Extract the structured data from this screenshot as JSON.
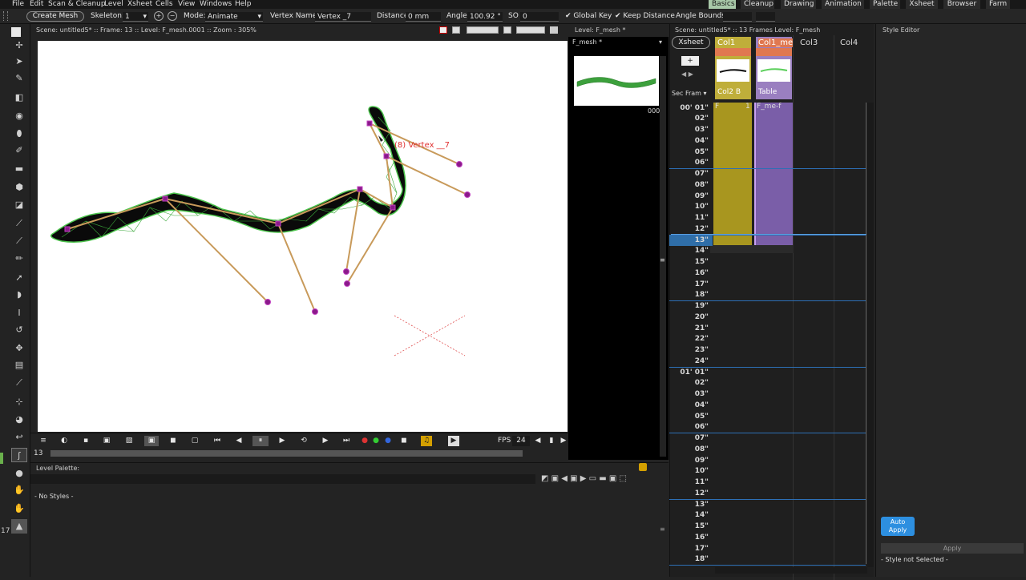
{
  "menu": [
    "File",
    "Edit",
    "Scan & Cleanup",
    "Level",
    "Xsheet",
    "Cells",
    "View",
    "Windows",
    "Help"
  ],
  "rooms": [
    {
      "label": "Basics",
      "active": true
    },
    {
      "label": "Cleanup",
      "active": false
    },
    {
      "label": "Drawing",
      "active": false
    },
    {
      "label": "Animation",
      "active": false
    },
    {
      "label": "Palette",
      "active": false
    },
    {
      "label": "Xsheet",
      "active": false
    },
    {
      "label": "Browser",
      "active": false
    },
    {
      "label": "Farm",
      "active": false
    }
  ],
  "tool_options": {
    "create_mesh": "Create Mesh",
    "skeleton_label": "Skeleton:",
    "skeleton_value": "1",
    "mode_label": "Mode:",
    "mode_value": "Animate",
    "vertex_name_label": "Vertex Name:",
    "vertex_name_value": "Vertex _7",
    "distance_label": "Distance",
    "distance_value": "0 mm",
    "angle_label": "Angle",
    "angle_value": "100.92 °",
    "so_label": "SO",
    "so_value": "0",
    "global_key": "Global Key",
    "keep_distance": "Keep Distance",
    "angle_bounds": "Angle Bounds"
  },
  "viewer": {
    "header": "Scene: untitled5*  ::  Frame: 13  ::  Level: F_mesh.0001  ::  Zoom : 305%",
    "vertex_label": "(8)  Vertex  __7",
    "fps_label": "FPS",
    "fps_value": "24",
    "frame_field": "13"
  },
  "level_strip": {
    "header": "Level:  F_mesh *",
    "level_name": "F_mesh *",
    "thumb_frame": "000"
  },
  "palette": {
    "title": "Level Palette:",
    "empty_text": "- No Styles -"
  },
  "xsheet": {
    "header": "Scene: untitled5*  ::  13 Frames  Level: F_mesh",
    "tab": "Xsheet",
    "sec_frame": "Sec Fram",
    "columns": [
      {
        "name": "Col1",
        "sub": "Col2   B",
        "color": "#bfae3a"
      },
      {
        "name": "Col1_me",
        "sub": "Table",
        "color": "#9a7fc0"
      },
      {
        "name": "Col3",
        "sub": "",
        "color": ""
      },
      {
        "name": "Col4",
        "sub": "",
        "color": ""
      }
    ],
    "cell_label_col1": "F",
    "cell_num_col1": "1",
    "cell_label_col2": "F_me-f",
    "frames": [
      "00' 01\"",
      "02\"",
      "03\"",
      "04\"",
      "05\"",
      "06\"",
      "07\"",
      "08\"",
      "09\"",
      "10\"",
      "11\"",
      "12\"",
      "13\"",
      "14\"",
      "15\"",
      "16\"",
      "17\"",
      "18\"",
      "19\"",
      "20\"",
      "21\"",
      "22\"",
      "23\"",
      "24\"",
      "01' 01\"",
      "02\"",
      "03\"",
      "04\"",
      "05\"",
      "06\"",
      "07\"",
      "08\"",
      "09\"",
      "10\"",
      "11\"",
      "12\"",
      "13\"",
      "14\"",
      "15\"",
      "16\"",
      "17\"",
      "18\""
    ],
    "current_frame": 13
  },
  "style_editor": {
    "title": "Style Editor",
    "auto_apply": "Auto\nApply",
    "apply": "Apply",
    "status": "- Style not Selected -"
  },
  "sidebar_number": "17"
}
